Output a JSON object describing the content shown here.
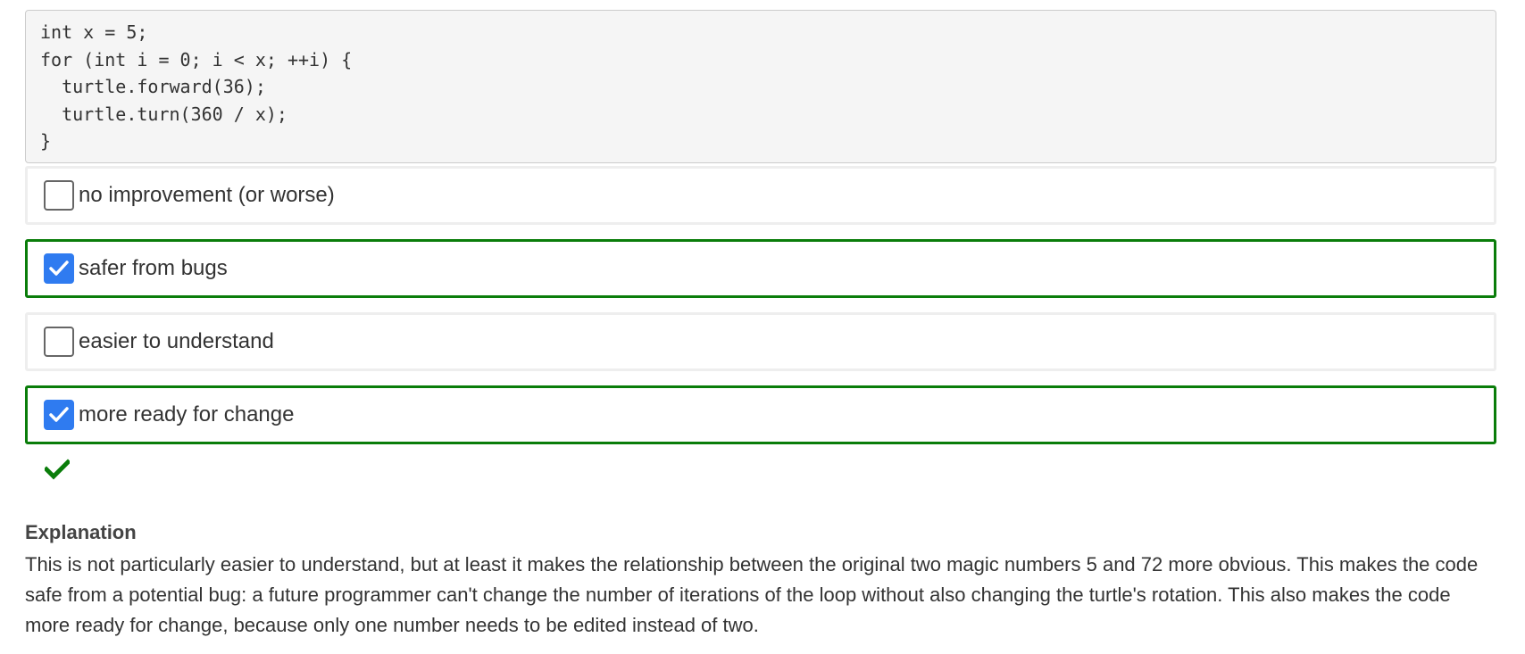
{
  "code": {
    "lines": [
      "int x = 5;",
      "for (int i = 0; i < x; ++i) {",
      "  turtle.forward(36);",
      "  turtle.turn(360 / x);",
      "}"
    ]
  },
  "options": [
    {
      "label": "no improvement (or worse)",
      "checked": false,
      "correct": false
    },
    {
      "label": "safer from bugs",
      "checked": true,
      "correct": true
    },
    {
      "label": "easier to understand",
      "checked": false,
      "correct": false
    },
    {
      "label": "more ready for change",
      "checked": true,
      "correct": true
    }
  ],
  "result": {
    "icon": "checkmark-icon",
    "color": "#0a7d0a"
  },
  "explanation": {
    "title": "Explanation",
    "text": "This is not particularly easier to understand, but at least it makes the relationship between the original two magic numbers 5 and 72 more obvious. This makes the code safe from a potential bug: a future programmer can't change the number of iterations of the loop without also changing the turtle's rotation. This also makes the code more ready for change, because only one number needs to be edited instead of two."
  },
  "colors": {
    "correct_border": "#0a7d0a",
    "checkbox_checked": "#2f7bf0",
    "default_border": "#eeeeee"
  }
}
